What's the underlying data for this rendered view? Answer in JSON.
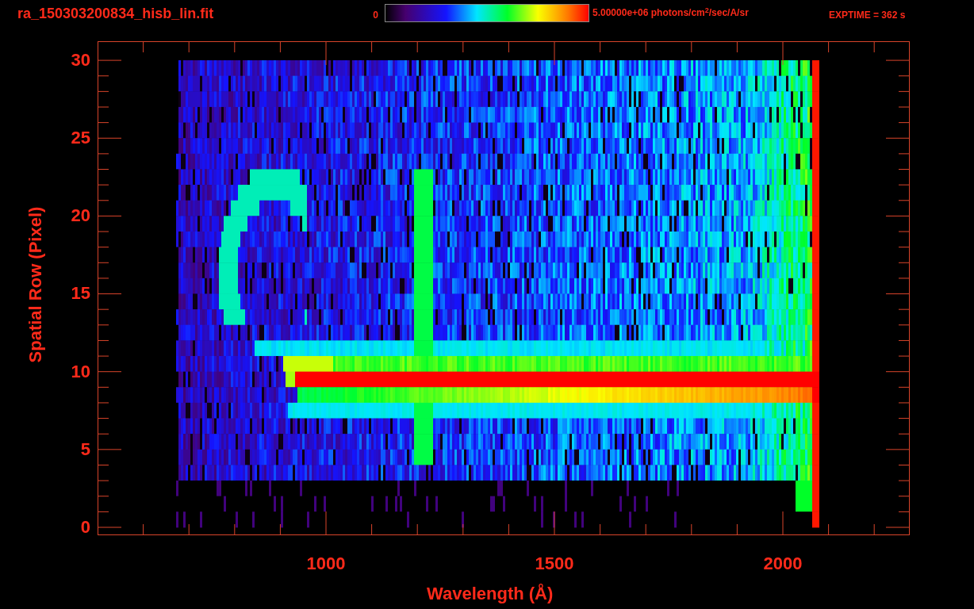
{
  "title": "ra_150303200834_hisb_lin.fit",
  "colorbar": {
    "min_label": "0",
    "max_label": "5.00000e+06 photons/cm$^{2}$/sec/A/sr"
  },
  "exposure": "EXPTIME = 362 s",
  "plot": {
    "xlabel": "Wavelength (Å)",
    "ylabel": "Spatial Row (Pixel)",
    "xticks": [
      "1000",
      "1500",
      "2000"
    ],
    "yticks": [
      "30",
      "25",
      "20",
      "15",
      "10",
      "5",
      "0"
    ]
  }
}
